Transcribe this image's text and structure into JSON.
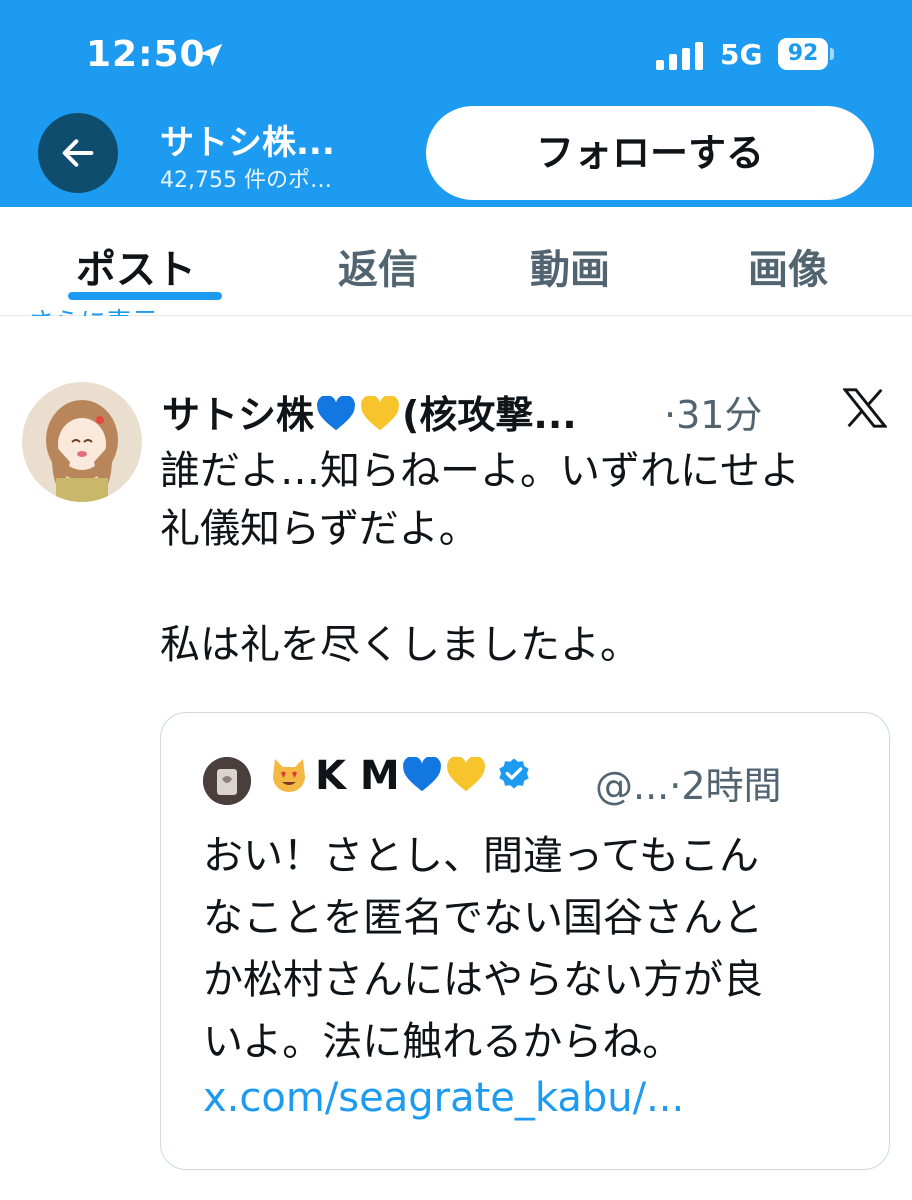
{
  "status_bar": {
    "time": "12:50",
    "network": "5G",
    "battery": "92"
  },
  "header": {
    "title": "サトシ株...",
    "subtitle": "42,755 件のポ…",
    "follow_label": "フォローする"
  },
  "tabs": [
    {
      "label": "ポスト",
      "active": true
    },
    {
      "label": "返信"
    },
    {
      "label": "動画"
    },
    {
      "label": "画像"
    }
  ],
  "partial_text": "さらに表示",
  "post": {
    "author_prefix": "サトシ株",
    "author_suffix": "(核攻撃...",
    "time": "·31分",
    "lines": [
      "誰だよ…知らねーよ。いずれにせよ",
      "礼儀知らずだよ。",
      "",
      "私は礼を尽くしましたよ。"
    ]
  },
  "quote": {
    "name": "K M",
    "handle": "@...·2時間",
    "lines": [
      "おい！さとし、間違ってもこん",
      "なことを匿名でない国谷さんと",
      "か松村さんにはやらない方が良",
      "いよ。法に触れるからね。"
    ],
    "link": "x.com/seagrate_kabu/..."
  },
  "colors": {
    "accent": "#1d9bf0",
    "heart_blue": "#1277e1",
    "heart_yellow": "#f7c52b"
  }
}
